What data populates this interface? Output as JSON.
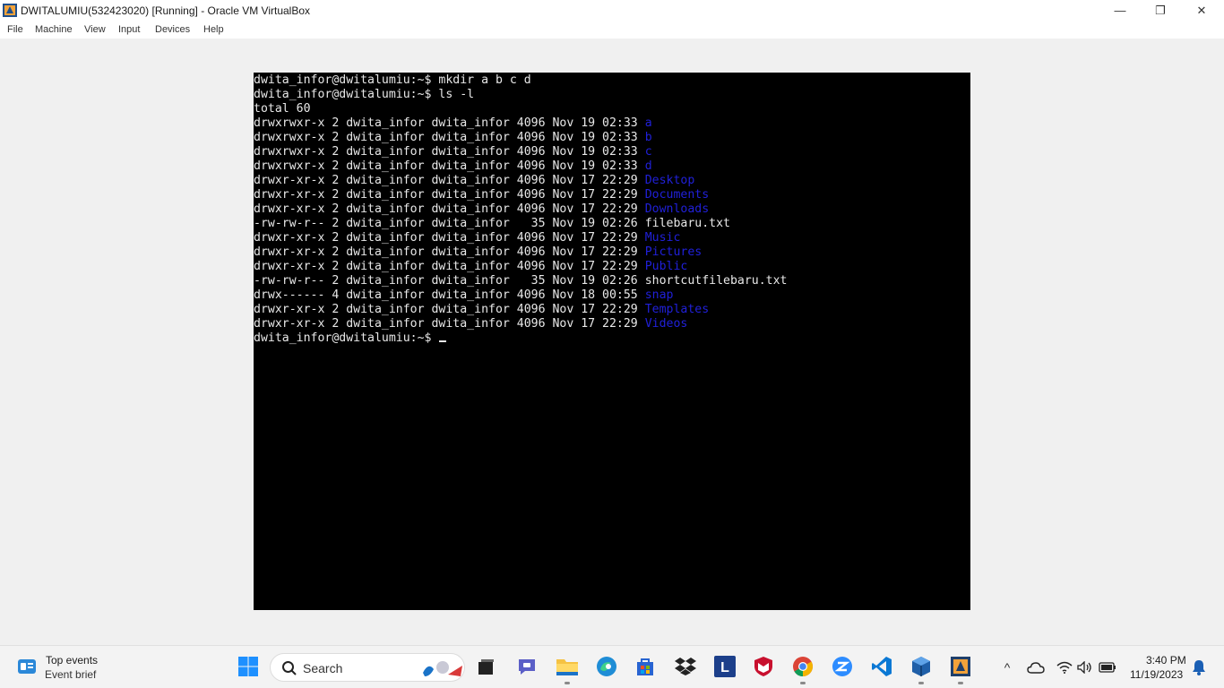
{
  "window": {
    "title": "DWITALUMIU(532423020) [Running] - Oracle VM VirtualBox",
    "minimize_glyph": "—",
    "maximize_glyph": "❐",
    "close_glyph": "✕"
  },
  "menu": {
    "items": [
      {
        "label": "File"
      },
      {
        "label": "Machine"
      },
      {
        "label": "View"
      },
      {
        "label": "Input"
      },
      {
        "label": "Devices"
      },
      {
        "label": "Help"
      }
    ]
  },
  "terminal": {
    "colors": {
      "background": "#000000",
      "text": "#e8e8e8",
      "directory": "#2020d8"
    },
    "lines": [
      {
        "text": "dwita_infor@dwitalumiu:~$ mkdir a b c d",
        "name": ""
      },
      {
        "text": "dwita_infor@dwitalumiu:~$ ls -l",
        "name": ""
      },
      {
        "text": "total 60",
        "name": ""
      },
      {
        "text": "drwxrwxr-x 2 dwita_infor dwita_infor 4096 Nov 19 02:33 ",
        "name": "a",
        "dir": true
      },
      {
        "text": "drwxrwxr-x 2 dwita_infor dwita_infor 4096 Nov 19 02:33 ",
        "name": "b",
        "dir": true
      },
      {
        "text": "drwxrwxr-x 2 dwita_infor dwita_infor 4096 Nov 19 02:33 ",
        "name": "c",
        "dir": true
      },
      {
        "text": "drwxrwxr-x 2 dwita_infor dwita_infor 4096 Nov 19 02:33 ",
        "name": "d",
        "dir": true
      },
      {
        "text": "drwxr-xr-x 2 dwita_infor dwita_infor 4096 Nov 17 22:29 ",
        "name": "Desktop",
        "dir": true
      },
      {
        "text": "drwxr-xr-x 2 dwita_infor dwita_infor 4096 Nov 17 22:29 ",
        "name": "Documents",
        "dir": true
      },
      {
        "text": "drwxr-xr-x 2 dwita_infor dwita_infor 4096 Nov 17 22:29 ",
        "name": "Downloads",
        "dir": true
      },
      {
        "text": "-rw-rw-r-- 2 dwita_infor dwita_infor   35 Nov 19 02:26 ",
        "name": "filebaru.txt",
        "dir": false
      },
      {
        "text": "drwxr-xr-x 2 dwita_infor dwita_infor 4096 Nov 17 22:29 ",
        "name": "Music",
        "dir": true
      },
      {
        "text": "drwxr-xr-x 2 dwita_infor dwita_infor 4096 Nov 17 22:29 ",
        "name": "Pictures",
        "dir": true
      },
      {
        "text": "drwxr-xr-x 2 dwita_infor dwita_infor 4096 Nov 17 22:29 ",
        "name": "Public",
        "dir": true
      },
      {
        "text": "-rw-rw-r-- 2 dwita_infor dwita_infor   35 Nov 19 02:26 ",
        "name": "shortcutfilebaru.txt",
        "dir": false
      },
      {
        "text": "drwx------ 4 dwita_infor dwita_infor 4096 Nov 18 00:55 ",
        "name": "snap",
        "dir": true
      },
      {
        "text": "drwxr-xr-x 2 dwita_infor dwita_infor 4096 Nov 17 22:29 ",
        "name": "Templates",
        "dir": true
      },
      {
        "text": "drwxr-xr-x 2 dwita_infor dwita_infor 4096 Nov 17 22:29 ",
        "name": "Videos",
        "dir": true
      }
    ],
    "prompt": "dwita_infor@dwitalumiu:~$ "
  },
  "taskbar": {
    "widget": {
      "title": "Top events",
      "subtitle": "Event brief",
      "icon": "news-widget-icon"
    },
    "search": {
      "placeholder": "Search"
    },
    "apps": [
      {
        "name": "start-button",
        "icon": "windows-logo-icon"
      },
      {
        "name": "task-view-button",
        "icon": "task-view-icon"
      },
      {
        "name": "teams-chat-app",
        "icon": "chat-icon"
      },
      {
        "name": "file-explorer-app",
        "icon": "folder-icon"
      },
      {
        "name": "edge-app",
        "icon": "edge-icon"
      },
      {
        "name": "microsoft-store-app",
        "icon": "store-icon"
      },
      {
        "name": "dropbox-app",
        "icon": "dropbox-icon"
      },
      {
        "name": "l-app",
        "icon": "l-icon"
      },
      {
        "name": "mcafee-app",
        "icon": "mcafee-icon"
      },
      {
        "name": "chrome-app",
        "icon": "chrome-icon"
      },
      {
        "name": "zoom-app",
        "icon": "zoom-icon"
      },
      {
        "name": "vscode-app",
        "icon": "vscode-icon"
      },
      {
        "name": "virtualbox-app",
        "icon": "virtualbox-icon"
      },
      {
        "name": "virtualbox-vm-app",
        "icon": "virtualbox-vm-icon"
      }
    ],
    "l_glyph": "L",
    "tray": {
      "chevron": "^",
      "time": "3:40 PM",
      "date": "11/19/2023"
    }
  }
}
